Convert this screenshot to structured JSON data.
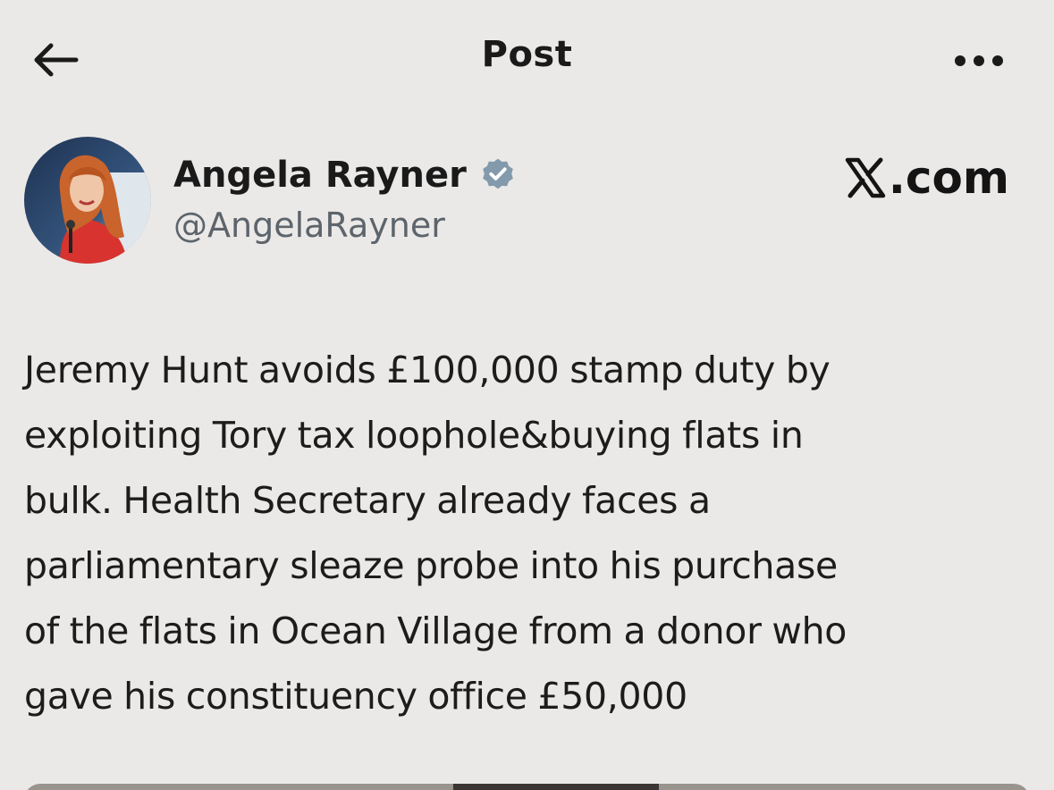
{
  "header": {
    "title": "Post",
    "back_icon": "arrow-left-icon",
    "more_icon": "more-horizontal-icon"
  },
  "author": {
    "name": "Angela Rayner",
    "handle": "@AngelaRayner",
    "verified": true,
    "verified_badge_color": "#829aab"
  },
  "watermark": {
    "text": ".com",
    "logo_icon": "x-logo-icon"
  },
  "post": {
    "lines": [
      "Jeremy Hunt avoids £100,000 stamp duty by",
      "exploiting Tory tax loophole&buying flats in",
      "bulk. Health Secretary already faces a",
      "parliamentary sleaze probe into his purchase",
      "of the flats in Ocean Village from a donor who",
      "gave his constituency office £50,000"
    ]
  },
  "colors": {
    "background": "#ebe9e7",
    "text": "#1a1a1a",
    "handle": "#5d646b"
  }
}
